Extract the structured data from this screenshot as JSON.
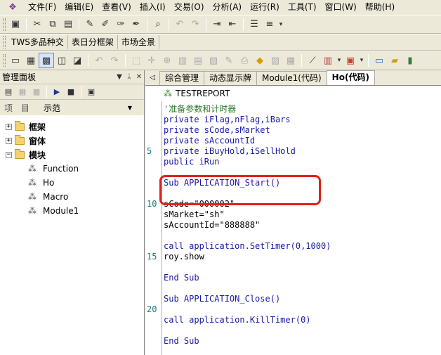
{
  "menubar": {
    "items": [
      "文件(F)",
      "编辑(E)",
      "查看(V)",
      "插入(I)",
      "交易(O)",
      "分析(A)",
      "运行(R)",
      "工具(T)",
      "窗口(W)",
      "帮助(H)"
    ]
  },
  "toolbar2": {
    "items": [
      "TWS多品种交",
      "表日分框架",
      "市场全景"
    ]
  },
  "left_panel": {
    "title": "管理面板",
    "combo_label": "项 目",
    "combo_value": "示范",
    "tree": [
      {
        "label": "框架",
        "expander": "+"
      },
      {
        "label": "窗体",
        "expander": "+"
      },
      {
        "label": "模块",
        "expander": "−"
      }
    ],
    "modules": [
      "Function",
      "Ho",
      "Macro",
      "Module1"
    ]
  },
  "tabs": [
    "综合管理",
    "动态显示牌",
    "Module1(代码)",
    "Ho(代码)"
  ],
  "report_label": "TESTREPORT",
  "line_numbers": [
    "5",
    "10",
    "15",
    "20"
  ],
  "code_lines": [
    "'准备参数和计时器",
    "private iFlag,nFlag,iBars",
    "private sCode,sMarket",
    "private sAccountId",
    "private iBuyHold,iSellHold",
    "public iRun",
    "",
    "Sub APPLICATION_Start()",
    "",
    "sCode=\"000002\"",
    "sMarket=\"sh\"",
    "sAccountId=\"888888\"",
    "",
    "call application.SetTimer(0,1000)",
    "roy.show",
    "",
    "End Sub",
    "",
    "Sub APPLICATION_Close()",
    "",
    "call application.KillTimer(0)",
    "",
    "End Sub"
  ],
  "colors": {
    "keyword": "#1a1aa6",
    "comment": "#2a7a2a",
    "highlight": "#e0201c"
  }
}
